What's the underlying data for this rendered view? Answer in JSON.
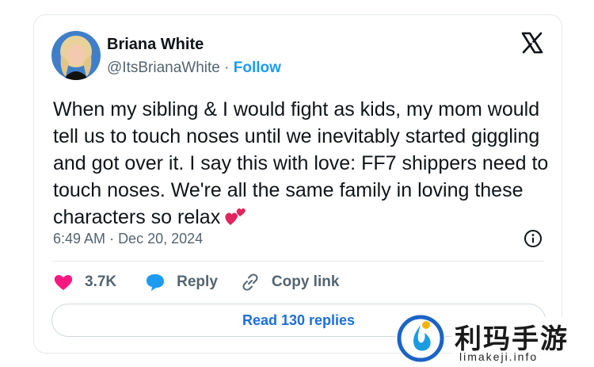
{
  "tweet": {
    "author_name": "Briana White",
    "handle": "@ItsBrianaWhite",
    "separator": " · ",
    "follow_label": "Follow",
    "text": "When my sibling & I would fight as kids, my mom would tell us to touch noses until we inevitably started giggling and got over it. I say this with love: FF7 shippers need to touch noses. We're all the same family in loving these characters so relax",
    "emoji_icon": "two-hearts-icon",
    "time": "6:49 AM",
    "date": "Dec 20, 2024",
    "likes": "3.7K",
    "reply_label": "Reply",
    "copy_link_label": "Copy link",
    "read_replies_label": "Read 130 replies"
  },
  "watermark": {
    "brand_cn": "利玛手游",
    "url": "limakeji.info"
  },
  "colors": {
    "accent": "#1d9bf0",
    "heart": "#f91880",
    "text": "#0f1419",
    "secondary": "#536471"
  }
}
